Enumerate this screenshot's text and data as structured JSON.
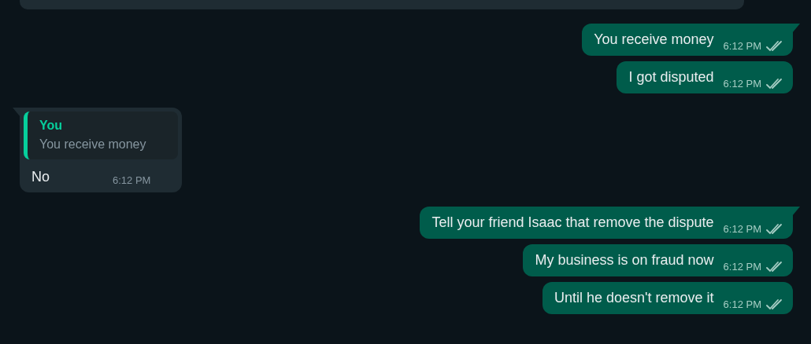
{
  "messages": [
    {
      "kind": "outgoing",
      "text": "You receive money",
      "time": "6:12 PM",
      "read": false,
      "first_in_group": true
    },
    {
      "kind": "outgoing",
      "text": "I got disputed",
      "time": "6:12 PM",
      "read": false,
      "first_in_group": false
    },
    {
      "kind": "incoming",
      "quote": {
        "author": "You",
        "text": "You receive money"
      },
      "text": "No",
      "time": "6:12 PM",
      "first_in_group": true
    },
    {
      "kind": "outgoing",
      "text": "Tell your friend Isaac that remove the dispute",
      "time": "6:12 PM",
      "read": false,
      "first_in_group": true
    },
    {
      "kind": "outgoing",
      "text": "My business is on fraud now",
      "time": "6:12 PM",
      "read": false,
      "first_in_group": false
    },
    {
      "kind": "outgoing",
      "text": "Until he doesn't remove it",
      "time": "6:12 PM",
      "read": false,
      "first_in_group": false
    }
  ]
}
